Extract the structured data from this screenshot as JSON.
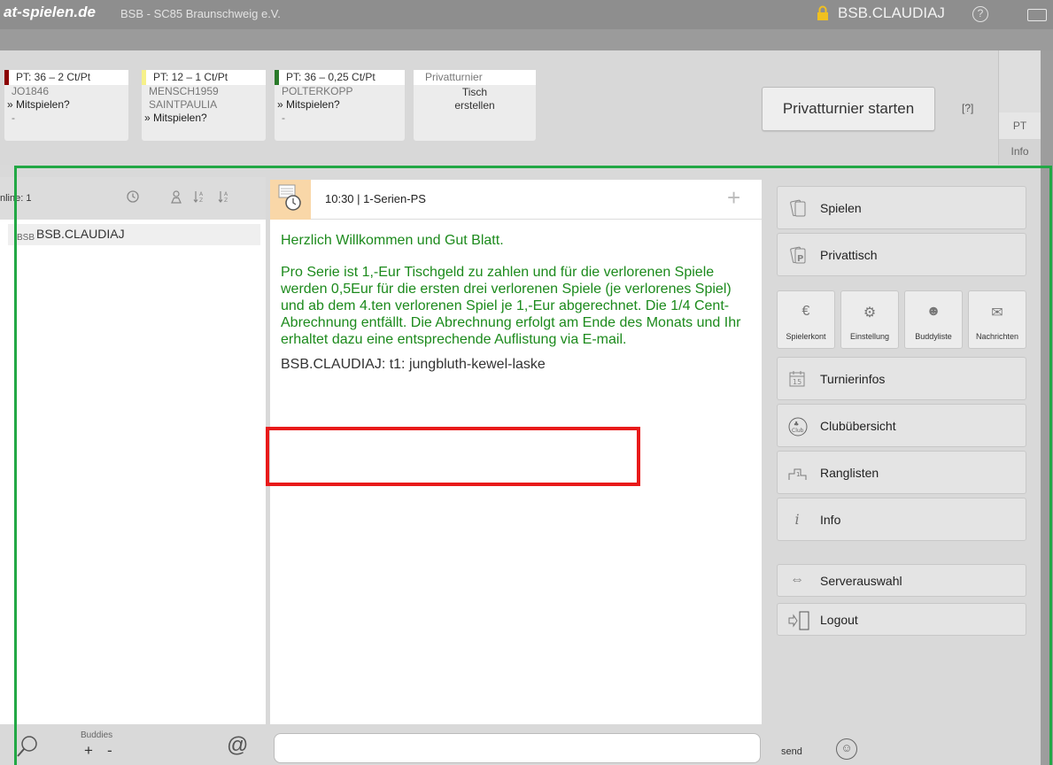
{
  "header": {
    "brand": "at-spielen.de",
    "club": "BSB - SC85 Braunschweig e.V.",
    "user": "BSB.CLAUDIAJ",
    "help_icon": "?",
    "window_icon": "window-icon"
  },
  "tables": [
    {
      "header": "PT: 36 – 2 Ct/Pt",
      "color": "#8b0000",
      "lines": [
        "JO1846",
        "» Mitspielen?",
        "-"
      ]
    },
    {
      "header": "PT: 12 – 1 Ct/Pt",
      "color": "#f6f18a",
      "lines": [
        "MENSCH1959",
        "SAINTPAULIA",
        "» Mitspielen?"
      ]
    },
    {
      "header": "PT: 36 – 0,25 Ct/Pt",
      "color": "#2a7a2a",
      "lines": [
        "POLTERKOPP",
        "» Mitspielen?",
        "-"
      ]
    },
    {
      "header": "Privatturnier",
      "color": "#ffffff",
      "lines": [
        "Tisch",
        "erstellen"
      ]
    }
  ],
  "privatturnier_button": "Privatturnier starten",
  "help_link": "[?]",
  "side_tabs": [
    "PT",
    "Info"
  ],
  "left_panel": {
    "online_label": "nline: 1",
    "player_club": "BSB",
    "player_name": "BSB.CLAUDIAJ",
    "footer": {
      "buddies_label": "Buddies",
      "plus": "+",
      "minus": "-",
      "at": "@"
    }
  },
  "chat": {
    "title": "10:30 | 1-Serien-PS",
    "welcome": "Herzlich Willkommen und Gut Blatt.",
    "info": "Pro Serie ist 1,-Eur Tischgeld zu zahlen und für die verlorenen Spiele werden 0,5Eur für die ersten drei verlorenen Spiele (je verlorenes Spiel) und ab dem 4.ten verlorenen Spiel je 1,-Eur abgerechnet. Die 1/4 Cent-Abrechnung entfällt. Die Abrechnung erfolgt am Ende des Monats und Ihr erhaltet dazu eine entsprechende Auflistung via E-mail.",
    "message": "BSB.CLAUDIAJ: t1: jungbluth-kewel-laske",
    "send_label": "send",
    "input_value": ""
  },
  "menu": {
    "spielen": "Spielen",
    "privattisch": "Privattisch",
    "squares": [
      "Spielerkont",
      "Einstellung",
      "Buddyliste",
      "Nachrichten"
    ],
    "turnierinfos": "Turnierinfos",
    "cluebersicht": "Clubübersicht",
    "ranglisten": "Ranglisten",
    "info": "Info",
    "serverauswahl": "Serverauswahl",
    "logout": "Logout"
  }
}
